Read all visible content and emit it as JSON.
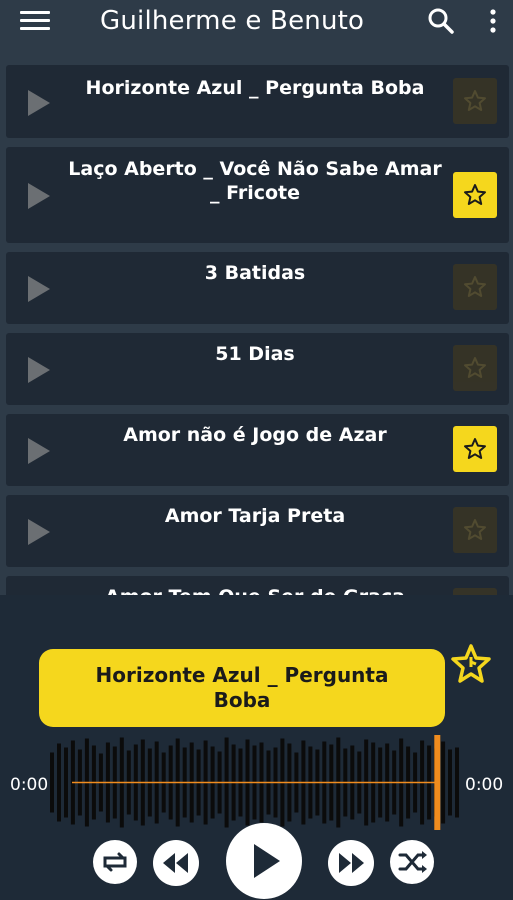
{
  "app": {
    "title": "Guilherme e Benuto"
  },
  "songs": [
    {
      "title": "Horizonte Azul _ Pergunta Boba",
      "favorite": false
    },
    {
      "title": "Laço Aberto _ Você Não Sabe Amar _ Fricote",
      "favorite": true
    },
    {
      "title": "3 Batidas",
      "favorite": false
    },
    {
      "title": "51 Dias",
      "favorite": false
    },
    {
      "title": "Amor não é Jogo de Azar",
      "favorite": true
    },
    {
      "title": "Amor Tarja Preta",
      "favorite": false
    },
    {
      "title": "Amor Tem Que Ser de Graça",
      "favorite": false
    }
  ],
  "player": {
    "now_playing": "Horizonte Azul _ Pergunta Boba",
    "elapsed": "0:00",
    "duration": "0:00",
    "progress": 0.94
  },
  "icons": {
    "menu": "menu-icon",
    "search": "search-icon",
    "more": "more-vertical-icon",
    "play": "play-icon",
    "star": "star-icon",
    "repeat": "repeat-icon",
    "rewind": "rewind-icon",
    "fast_forward": "fast-forward-icon",
    "shuffle": "shuffle-icon"
  },
  "colors": {
    "accent": "#f5d71d",
    "background": "#2e3b48",
    "card": "#1f2935",
    "progress": "#f08c1e"
  }
}
